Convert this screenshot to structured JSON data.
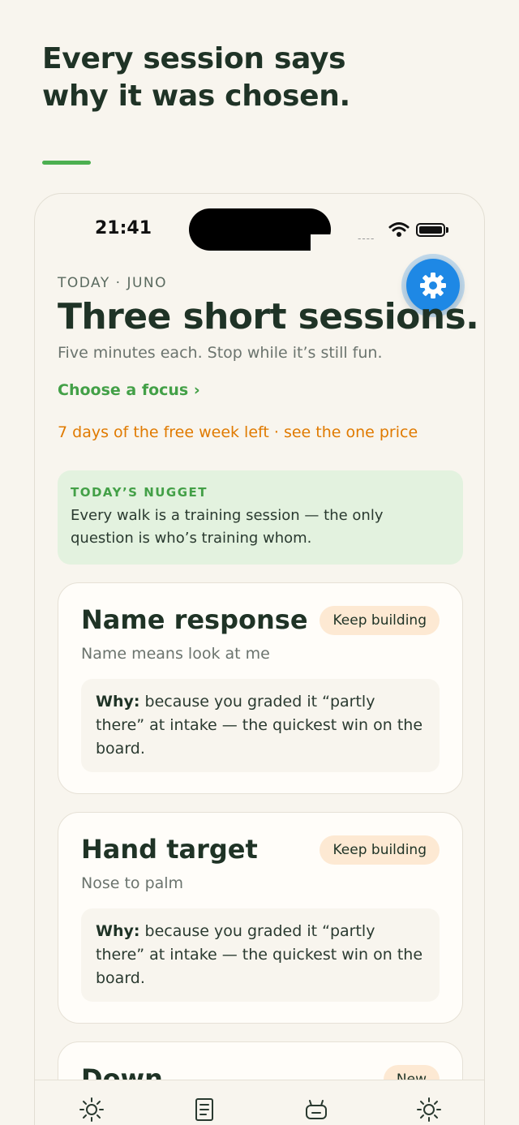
{
  "headline": {
    "line1": "Every session says",
    "line2": "why it was chosen."
  },
  "status_bar": {
    "time": "21:41",
    "signal_text": "----"
  },
  "header": {
    "eyebrow": "TODAY · JUNO",
    "title": "Three short sessions.",
    "subtitle": "Five minutes each. Stop while it’s still fun.",
    "focus_link": "Choose a focus ›",
    "trial_link": "7 days of the free week left · see the one price"
  },
  "nugget": {
    "label": "TODAY’S NUGGET",
    "text": "Every walk is a training session — the only question is who’s training whom."
  },
  "cards": [
    {
      "title": "Name response",
      "badge": "Keep building",
      "subtitle": "Name means look at me",
      "why_label": "Why:",
      "why_text": " because you graded it “partly there” at intake — the quickest win on the board."
    },
    {
      "title": "Hand target",
      "badge": "Keep building",
      "subtitle": "Nose to palm",
      "why_label": "Why:",
      "why_text": " because you graded it “partly there” at intake — the quickest win on the board."
    },
    {
      "title": "Down",
      "badge": "New"
    }
  ],
  "tabs": [
    {
      "icon": "sun-icon"
    },
    {
      "icon": "notes-icon"
    },
    {
      "icon": "robot-icon"
    },
    {
      "icon": "settings-sun-icon"
    }
  ],
  "colors": {
    "accent_green": "#43a047",
    "trial_orange": "#e07a00",
    "fab_blue": "#1e88e5"
  }
}
